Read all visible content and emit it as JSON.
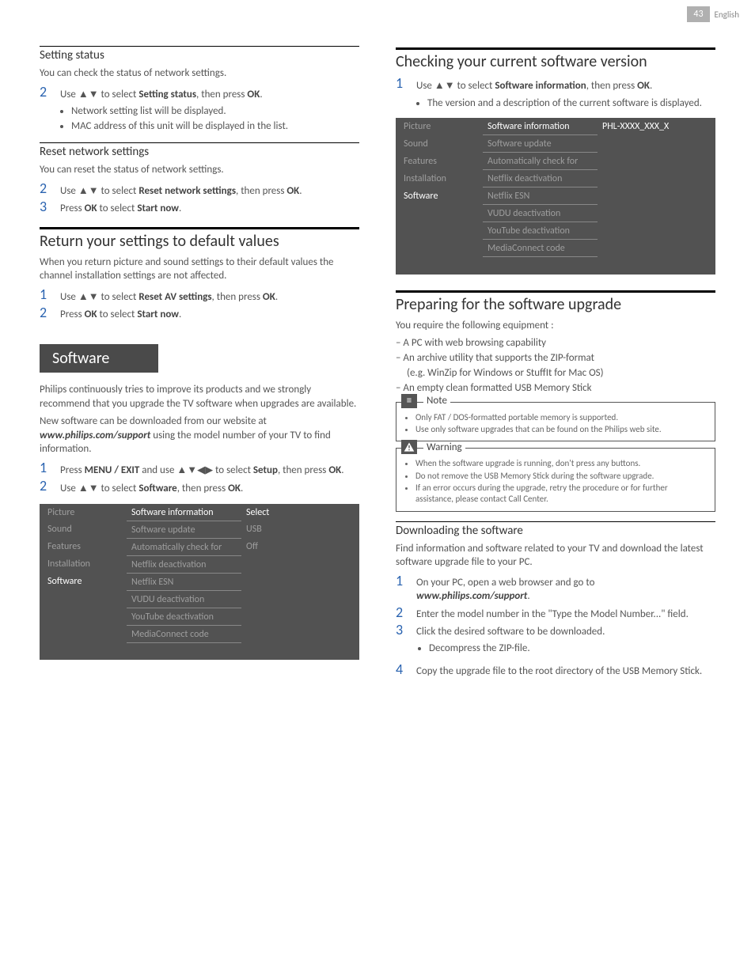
{
  "page": {
    "number": "43",
    "lang": "English"
  },
  "left": {
    "setting_status": {
      "heading": "Setting status",
      "intro": "You can check the status of network settings.",
      "step2_pre": "Use ",
      "step2_mid": " to select ",
      "step2_target": "Setting status",
      "step2_post": ", then press ",
      "ok": "OK",
      "bullets": [
        "Network setting list will be displayed.",
        "MAC address of this unit will be displayed in the list."
      ]
    },
    "reset_net": {
      "heading": "Reset network settings",
      "intro": "You can reset the status of network settings.",
      "s2_pre": "Use ",
      "s2_mid": " to select ",
      "s2_target": "Reset network settings",
      "s2_post": ", then press ",
      "ok": "OK",
      "s3_pre": "Press ",
      "s3_mid": " to select ",
      "s3_target": "Start now"
    },
    "return_def": {
      "heading": "Return your settings to default values",
      "intro": "When you return picture and sound settings to their default values the channel installation settings are not affected.",
      "s1_pre": "Use ",
      "s1_mid": " to select ",
      "s1_target": "Reset AV settings",
      "s1_post": ", then press ",
      "ok": "OK",
      "s2_pre": "Press ",
      "s2_mid": " to select ",
      "s2_target": "Start now"
    },
    "software": {
      "band": "Software",
      "p1": "Philips continuously tries to improve its products and we strongly recommend that you upgrade the TV software when upgrades are available.",
      "p2a": "New software can be downloaded from our website at ",
      "p2url": "www.philips.com/support",
      "p2b": " using the model number of your TV to find information.",
      "s1_pre": "Press ",
      "s1_menu": "MENU / EXIT",
      "s1_mid": " and use ",
      "s1_mid2": " to select ",
      "s1_target": "Setup",
      "s1_post": ", then press ",
      "ok": "OK",
      "s2_pre": "Use ",
      "s2_mid": " to select ",
      "s2_target": "Software",
      "s2_post": ", then press "
    },
    "menu1": {
      "side": [
        "Picture",
        "Sound",
        "Features",
        "Installation",
        "Software"
      ],
      "rows": [
        {
          "m": "Software information",
          "v": "Select"
        },
        {
          "m": "Software update",
          "v": "USB"
        },
        {
          "m": "Automatically check for",
          "v": "Off"
        },
        {
          "m": "Netflix deactivation",
          "v": ""
        },
        {
          "m": "Netflix ESN",
          "v": ""
        },
        {
          "m": "VUDU deactivation",
          "v": ""
        },
        {
          "m": "YouTube deactivation",
          "v": ""
        },
        {
          "m": "MediaConnect code",
          "v": ""
        }
      ]
    }
  },
  "right": {
    "check_sw": {
      "heading": "Checking your current software version",
      "s1_pre": "Use ",
      "s1_mid": " to select ",
      "s1_target": "Software information",
      "s1_post": ", then press ",
      "ok": "OK",
      "bullet": "The version and a description of the current software is displayed."
    },
    "menu2": {
      "side": [
        "Picture",
        "Sound",
        "Features",
        "Installation",
        "Software"
      ],
      "rows": [
        {
          "m": "Software information",
          "v": "PHL-XXXX_XXX_X"
        },
        {
          "m": "Software update",
          "v": ""
        },
        {
          "m": "Automatically check for",
          "v": ""
        },
        {
          "m": "Netflix deactivation",
          "v": ""
        },
        {
          "m": "Netflix ESN",
          "v": ""
        },
        {
          "m": "VUDU deactivation",
          "v": ""
        },
        {
          "m": "YouTube deactivation",
          "v": ""
        },
        {
          "m": "MediaConnect code",
          "v": ""
        }
      ]
    },
    "prepare": {
      "heading": "Preparing for the software upgrade",
      "intro": "You require the following equipment :",
      "dashes1": "A PC with web browsing capability",
      "dashes2a": "An archive utility that supports the ZIP-format",
      "dashes2b": "(e.g. WinZip for Windows or StuffIt for Mac OS)",
      "dashes3": "An empty clean formatted USB Memory Stick"
    },
    "note": {
      "title": "Note",
      "items": [
        "Only FAT / DOS-formatted portable memory is supported.",
        "Use only software upgrades that can be found on the Philips web site."
      ]
    },
    "warning": {
      "title": "Warning",
      "items": [
        "When the software upgrade is running, don't press any buttons.",
        "Do not remove the USB Memory Stick during the software upgrade.",
        "If an error occurs during the upgrade, retry the procedure or for further assistance, please contact Call Center."
      ]
    },
    "download": {
      "heading": "Downloading the software",
      "intro": "Find information and software related to your TV and download the latest software upgrade file to your PC.",
      "s1_pre": "On your PC, open a web browser and go to ",
      "s1_url": "www.philips.com/support",
      "s2": "Enter the model number in the \"Type the Model Number...\" field.",
      "s3": "Click the desired software to be downloaded.",
      "s3_bullet": "Decompress the ZIP-file.",
      "s4": "Copy the upgrade file to the root directory of the USB Memory Stick."
    }
  },
  "glyphs": {
    "ud": "▲▼",
    "udlr": "▲▼◀▶",
    "period": "."
  }
}
